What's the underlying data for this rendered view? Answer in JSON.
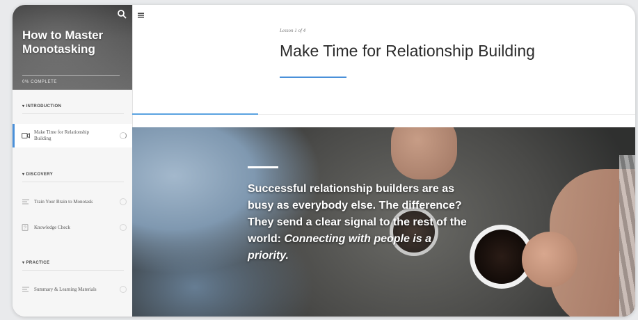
{
  "course": {
    "title": "How to Master Monotasking",
    "progress_label": "0% COMPLETE"
  },
  "sidebar": {
    "sections": [
      {
        "title": "▾ INTRODUCTION",
        "items": [
          {
            "label": "Make Time for Relationship Building",
            "icon": "video-lesson-icon",
            "active": true
          }
        ]
      },
      {
        "title": "▾ DISCOVERY",
        "items": [
          {
            "label": "Train Your Brain to Monotask",
            "icon": "text-lesson-icon",
            "active": false
          },
          {
            "label": "Knowledge Check",
            "icon": "quiz-icon",
            "active": false
          }
        ]
      },
      {
        "title": "▾ PRACTICE",
        "items": [
          {
            "label": "Summary & Learning Materials",
            "icon": "text-lesson-icon",
            "active": false
          }
        ]
      }
    ]
  },
  "lesson": {
    "count_label": "Lesson 1 of 4",
    "title": "Make Time for Relationship Building",
    "progress_fraction": 0.25
  },
  "hero": {
    "quote_plain": "Successful relationship builders are as busy as everybody else. The difference? They send a clear signal to the rest of the world: ",
    "quote_emphasis": "Connecting with people is a priority."
  },
  "colors": {
    "accent": "#4a90d9",
    "sidebar_bg": "#f6f6f6",
    "title_text": "#2b2b2b"
  }
}
